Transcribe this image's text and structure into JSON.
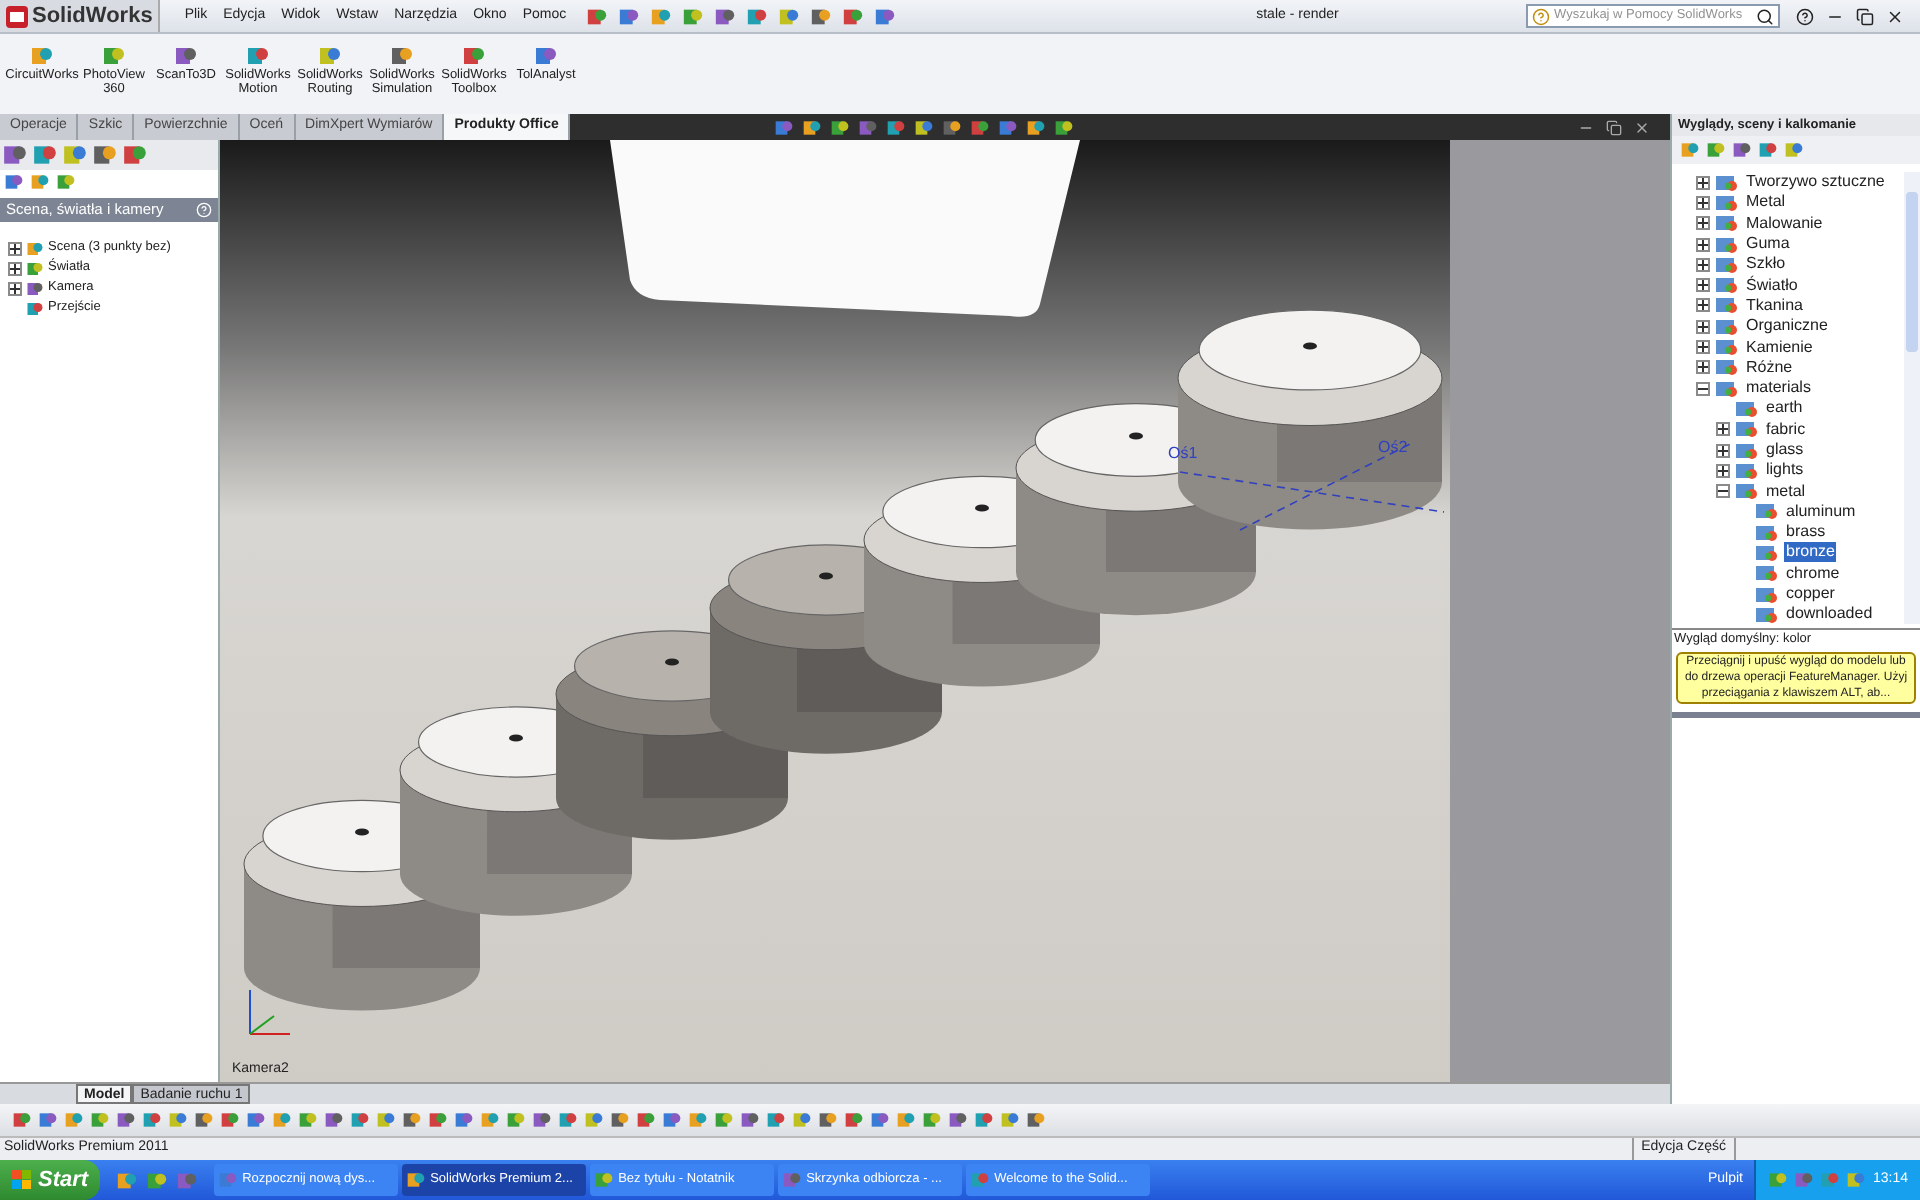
{
  "app_title": "SolidWorks",
  "menu": [
    "Plik",
    "Edycja",
    "Widok",
    "Wstaw",
    "Narzędzia",
    "Okno",
    "Pomoc"
  ],
  "document_title": "stale - render",
  "search": {
    "placeholder": "Wyszukaj w Pomocy SolidWorks"
  },
  "ribbon_buttons": [
    "CircuitWorks",
    "PhotoView 360",
    "ScanTo3D",
    "SolidWorks Motion",
    "SolidWorks Routing",
    "SolidWorks Simulation",
    "SolidWorks Toolbox",
    "TolAnalyst"
  ],
  "ribbon_tabs": [
    {
      "label": "Operacje",
      "selected": false
    },
    {
      "label": "Szkic",
      "selected": false
    },
    {
      "label": "Powierzchnie",
      "selected": false
    },
    {
      "label": "Oceń",
      "selected": false
    },
    {
      "label": "DimXpert Wymiarów",
      "selected": false
    },
    {
      "label": "Produkty Office",
      "selected": true
    }
  ],
  "left_panel": {
    "title": "Scena, światła i kamery",
    "tree": [
      {
        "label": "Scena (3 punkty bez)",
        "kind": "folder",
        "expanded": false
      },
      {
        "label": "Światła",
        "kind": "folder",
        "expanded": false
      },
      {
        "label": "Kamera",
        "kind": "folder",
        "expanded": false
      },
      {
        "label": "Przejście",
        "kind": "leaf"
      }
    ]
  },
  "viewport": {
    "axis_labels": [
      "Oś1",
      "Oś2"
    ],
    "camera_label": "Kamera2"
  },
  "right_panel": {
    "title": "Wyglądy, sceny i kalkomanie",
    "tree": [
      {
        "label": "Tworzywo sztuczne",
        "kind": "folder",
        "expanded": false
      },
      {
        "label": "Metal",
        "kind": "folder",
        "expanded": false
      },
      {
        "label": "Malowanie",
        "kind": "folder",
        "expanded": false
      },
      {
        "label": "Guma",
        "kind": "folder",
        "expanded": false
      },
      {
        "label": "Szkło",
        "kind": "folder",
        "expanded": false
      },
      {
        "label": "Światło",
        "kind": "folder",
        "expanded": false
      },
      {
        "label": "Tkanina",
        "kind": "folder",
        "expanded": false
      },
      {
        "label": "Organiczne",
        "kind": "folder",
        "expanded": false
      },
      {
        "label": "Kamienie",
        "kind": "folder",
        "expanded": false
      },
      {
        "label": "Różne",
        "kind": "folder",
        "expanded": false
      },
      {
        "label": "materials",
        "kind": "folder",
        "expanded": true,
        "children": [
          {
            "label": "earth",
            "kind": "leaf"
          },
          {
            "label": "fabric",
            "kind": "folder",
            "expanded": false
          },
          {
            "label": "glass",
            "kind": "folder",
            "expanded": false
          },
          {
            "label": "lights",
            "kind": "folder",
            "expanded": false
          },
          {
            "label": "metal",
            "kind": "folder",
            "expanded": true,
            "children": [
              {
                "label": "aluminum",
                "selected": false
              },
              {
                "label": "brass",
                "selected": false
              },
              {
                "label": "bronze",
                "selected": true
              },
              {
                "label": "chrome",
                "selected": false
              },
              {
                "label": "copper",
                "selected": false
              },
              {
                "label": "downloaded",
                "selected": false
              }
            ]
          }
        ]
      }
    ],
    "preview_label": "Wygląd domyślny: kolor",
    "hint": "Przeciągnij i upuść wygląd do modelu lub do drzewa operacji FeatureManager. Użyj przeciągania z klawiszem ALT, ab..."
  },
  "model_tabs": [
    {
      "label": "Model",
      "selected": true
    },
    {
      "label": "Badanie ruchu 1",
      "selected": false
    }
  ],
  "status_bar": {
    "product": "SolidWorks Premium 2011",
    "mode": "Edycja Część"
  },
  "taskbar": {
    "start": "Start",
    "tasks": [
      {
        "label": "Rozpocznij nową dys...",
        "selected": false
      },
      {
        "label": "SolidWorks Premium 2...",
        "selected": true
      },
      {
        "label": "Bez tytułu - Notatnik",
        "selected": false
      },
      {
        "label": "Skrzynka odbiorcza - ...",
        "selected": false
      },
      {
        "label": "Welcome to the Solid...",
        "selected": false
      }
    ],
    "desktop": "Pulpit",
    "clock": "13:14"
  }
}
